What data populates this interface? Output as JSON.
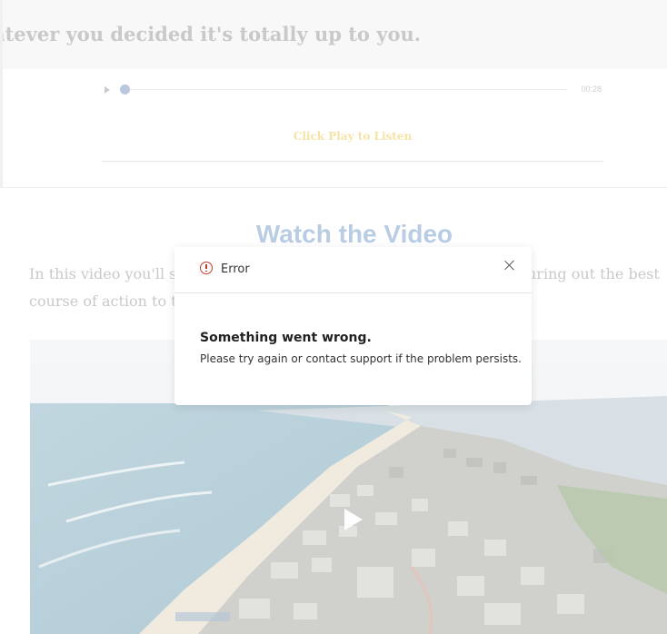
{
  "header": {
    "headline": "atever you decided it's totally up to you."
  },
  "audio": {
    "duration": "00:28",
    "listen_label": "Click Play to Listen",
    "progress_fraction": 0
  },
  "video_section": {
    "title": "Watch the Video",
    "intro_line1": "In this video you'll se",
    "intro_line1_right": "uring out the best",
    "intro_line2": "course of action to tal"
  },
  "modal": {
    "title": "Error",
    "heading": "Something went wrong.",
    "message": "Please try again or contact support if the problem persists.",
    "icon": "error-circle-icon",
    "close_icon": "close-icon"
  },
  "colors": {
    "error": "#c0392b",
    "title_blue": "#b8cde4",
    "listen_gold": "#f5e3a6"
  }
}
